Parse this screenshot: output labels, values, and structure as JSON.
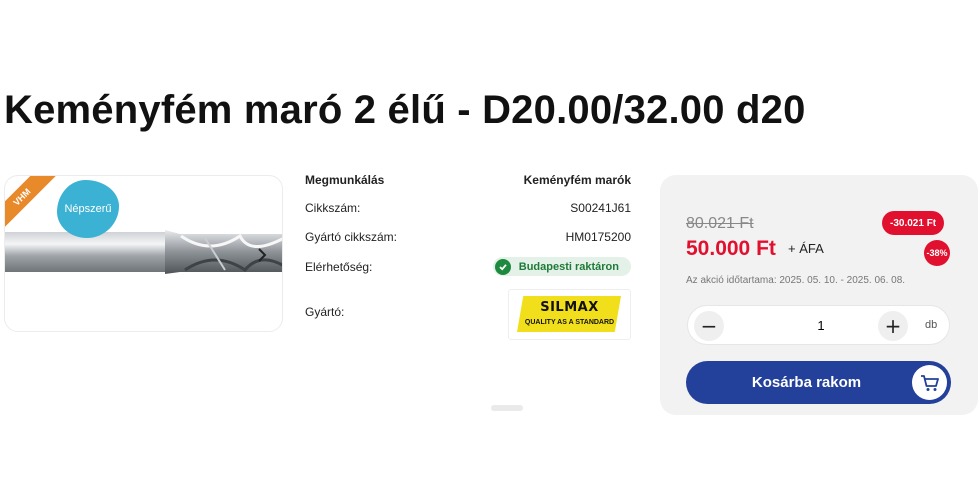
{
  "title": "Keményfém maró 2 élű - D20.00/32.00 d20",
  "image": {
    "ribbon_label": "VHM",
    "badge_label": "Népszerű",
    "nav_icon": "chevron-right-icon"
  },
  "specs": {
    "category_label": "Megmunkálás",
    "category_value": "Keményfém marók",
    "sku_label": "Cikkszám:",
    "sku_value": "S00241J61",
    "mfr_sku_label": "Gyártó cikkszám:",
    "mfr_sku_value": "HM0175200",
    "availability_label": "Elérhetőség:",
    "availability_value": "Budapesti raktáron",
    "manufacturer_label": "Gyártó:",
    "manufacturer_logo_name": "SILMAX",
    "manufacturer_logo_tagline": "QUALITY AS A STANDARD"
  },
  "price": {
    "old": "80.021 Ft",
    "current": "50.000 Ft",
    "vat_note": "+ ÁFA",
    "discount_amount": "-30.021 Ft",
    "discount_percent": "-38%",
    "promo_period": "Az akció időtartama: 2025. 05. 10. - 2025. 06. 08."
  },
  "quantity": {
    "value": "1",
    "unit": "db",
    "minus": "−",
    "plus": "+"
  },
  "cart_button_label": "Kosárba rakom",
  "colors": {
    "accent_blue": "#23409a",
    "price_red": "#e1102f",
    "stock_green": "#1e8a3f",
    "badge_cyan": "#3bb2d3",
    "ribbon_orange": "#e8892a"
  }
}
